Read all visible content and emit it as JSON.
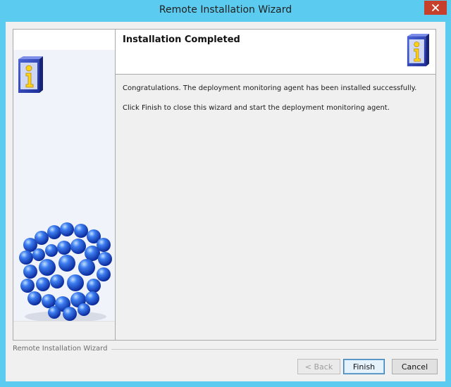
{
  "window": {
    "title": "Remote Installation Wizard",
    "close_glyph": "✕",
    "accent_color": "#5ccbf0",
    "close_color": "#c7402b"
  },
  "header": {
    "title": "Installation Completed",
    "icon": "info-box-icon"
  },
  "sidebar": {
    "top_icon": "info-box-icon",
    "bottom_image": "molecule-cube-icon"
  },
  "content": {
    "line1": "Congratulations. The deployment monitoring agent has been installed successfully.",
    "line2": "Click Finish to close this wizard and start the deployment monitoring agent."
  },
  "footer": {
    "group_label": "Remote Installation Wizard",
    "back_label": "< Back",
    "finish_label": "Finish",
    "cancel_label": "Cancel"
  }
}
